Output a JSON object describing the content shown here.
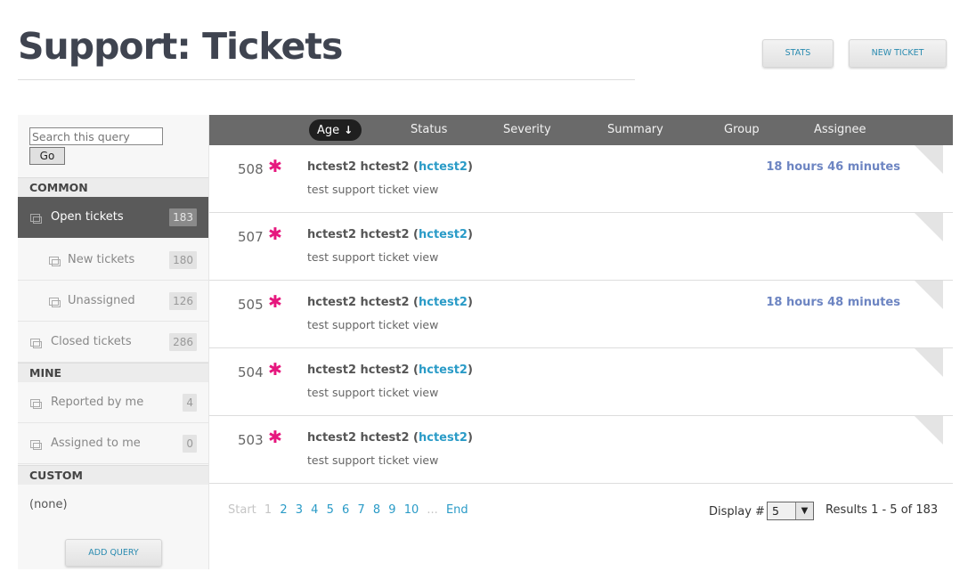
{
  "header": {
    "title": "Support: Tickets",
    "stats_label": "STATS",
    "new_ticket_label": "NEW TICKET"
  },
  "sidebar": {
    "search_placeholder": "Search this query",
    "go_label": "Go",
    "sections": {
      "common": "COMMON",
      "mine": "MINE",
      "custom": "CUSTOM"
    },
    "items": [
      {
        "label": "Open tickets",
        "count": "183",
        "active": true
      },
      {
        "label": "New tickets",
        "count": "180"
      },
      {
        "label": "Unassigned",
        "count": "126"
      },
      {
        "label": "Closed tickets",
        "count": "286"
      },
      {
        "label": "Reported by me",
        "count": "4"
      },
      {
        "label": "Assigned to me",
        "count": "0"
      }
    ],
    "custom_none": "(none)",
    "add_query_label": "ADD QUERY"
  },
  "table": {
    "columns": [
      "Age",
      "Status",
      "Severity",
      "Summary",
      "Group",
      "Assignee"
    ],
    "sorted_column": "Age",
    "rows": [
      {
        "id": "508",
        "name": "hctest2 hctest2",
        "user": "hctest2",
        "subject": "test support ticket view",
        "time": "18 hours 46 minutes"
      },
      {
        "id": "507",
        "name": "hctest2 hctest2",
        "user": "hctest2",
        "subject": "test support ticket view",
        "time": ""
      },
      {
        "id": "505",
        "name": "hctest2 hctest2",
        "user": "hctest2",
        "subject": "test support ticket view",
        "time": "18 hours 48 minutes"
      },
      {
        "id": "504",
        "name": "hctest2 hctest2",
        "user": "hctest2",
        "subject": "test support ticket view",
        "time": ""
      },
      {
        "id": "503",
        "name": "hctest2 hctest2",
        "user": "hctest2",
        "subject": "test support ticket view",
        "time": ""
      }
    ]
  },
  "pager": {
    "start": "Start",
    "current": "1",
    "pages": [
      "2",
      "3",
      "4",
      "5",
      "6",
      "7",
      "8",
      "9",
      "10"
    ],
    "ellipsis": "...",
    "end": "End",
    "display_label": "Display #",
    "display_value": "5",
    "results": "Results 1 - 5 of 183"
  },
  "colors": {
    "accent_link": "#2a9bc7",
    "star": "#e6177e",
    "time": "#6d85c2",
    "header_bg": "#6a6a6a"
  },
  "icons": {
    "ticket_flag": "asterisk-icon",
    "nav": "copy-icon",
    "sort": "arrow-down-icon",
    "select": "triangle-down-icon"
  }
}
